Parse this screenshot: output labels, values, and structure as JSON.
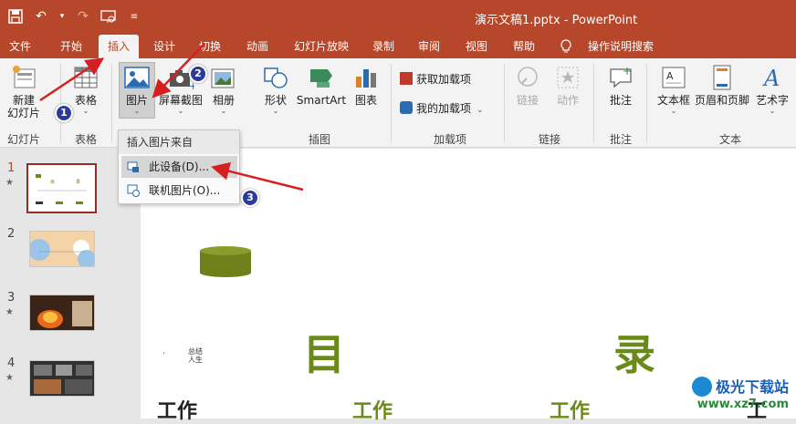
{
  "window": {
    "title": "演示文稿1.pptx  -  PowerPoint"
  },
  "qat": {
    "icons": [
      "save-icon",
      "undo-icon",
      "redo-icon",
      "present-icon",
      "customize-icon"
    ]
  },
  "tabs": [
    "文件",
    "开始",
    "插入",
    "设计",
    "切换",
    "动画",
    "幻灯片放映",
    "录制",
    "审阅",
    "视图",
    "帮助",
    "操作说明搜索"
  ],
  "active_tab": "插入",
  "ribbon": {
    "new_slide": "新建",
    "new_slide2": "幻灯片",
    "table": "表格",
    "picture": "图片",
    "screenshot": "屏幕截图",
    "album": "相册",
    "shapes": "形状",
    "smartart": "SmartArt",
    "chart": "图表",
    "get_addins": "获取加载项",
    "my_addins": "我的加载项",
    "link": "链接",
    "action": "动作",
    "comment": "批注",
    "textbox": "文本框",
    "header_footer": "页眉和页脚",
    "wordart": "艺术字",
    "groups": {
      "slides": "幻灯片",
      "tables": "表格",
      "images": "插图",
      "addins": "加载项",
      "links": "链接",
      "comments": "批注",
      "text": "文本"
    }
  },
  "dropdown": {
    "header": "插入图片来自",
    "items": [
      "此设备(D)...",
      "联机图片(O)..."
    ]
  },
  "badges": [
    "1",
    "2",
    "3"
  ],
  "slides": [
    {
      "num": "1",
      "star": "★"
    },
    {
      "num": "2",
      "star": ""
    },
    {
      "num": "3",
      "star": "★"
    },
    {
      "num": "4",
      "star": "★"
    }
  ],
  "canvas": {
    "char1": "目",
    "char2": "录",
    "work": [
      "工作",
      "工作",
      "工作",
      "工"
    ],
    "small_text": "总结\n人生"
  },
  "watermark": {
    "text": "极光下载站",
    "url": "www.xz7.com"
  },
  "colors": {
    "brand": "#b7472a",
    "annotation": "#d42020",
    "badge": "#2b3b9a",
    "olive": "#6a8a1a"
  }
}
